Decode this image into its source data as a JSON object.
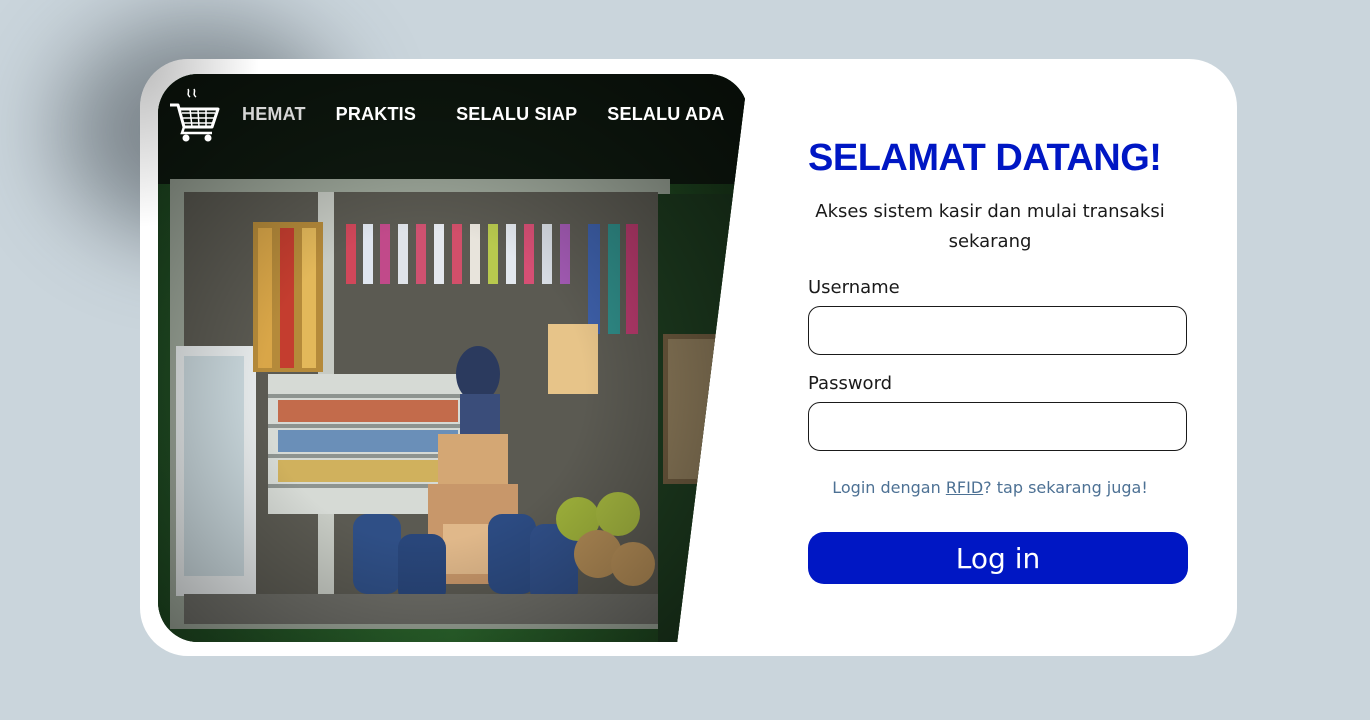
{
  "nav": {
    "logo_icon": "shopping-cart-icon",
    "items": [
      {
        "label": "HEMAT"
      },
      {
        "label": "PRAKTIS"
      },
      {
        "label": "SELALU SIAP"
      },
      {
        "label": "SELALU ADA"
      }
    ]
  },
  "login": {
    "title": "SELAMAT DATANG!",
    "subtitle": "Akses sistem kasir dan mulai transaksi sekarang",
    "username_label": "Username",
    "username_value": "",
    "password_label": "Password",
    "password_value": "",
    "rfid_prefix": "Login dengan ",
    "rfid_link": "RFID",
    "rfid_suffix": "? tap sekarang juga!",
    "button_label": "Log in"
  },
  "colors": {
    "accent": "#0017c4",
    "background": "#cad5dc",
    "card": "#ffffff",
    "link": "#4d7194"
  }
}
